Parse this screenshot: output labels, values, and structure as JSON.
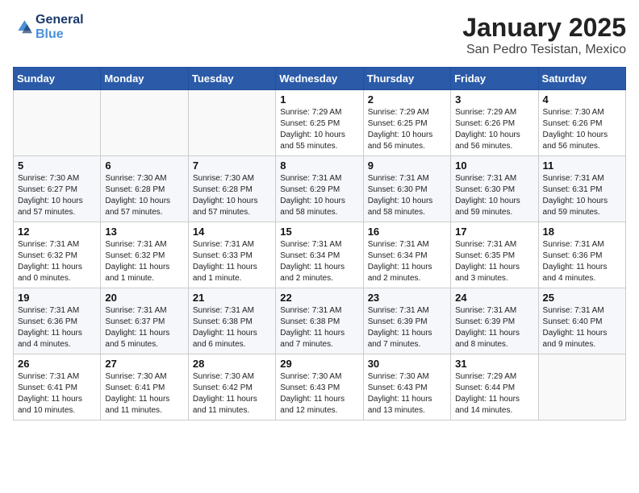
{
  "header": {
    "logo_line1": "General",
    "logo_line2": "Blue",
    "month": "January 2025",
    "location": "San Pedro Tesistan, Mexico"
  },
  "weekdays": [
    "Sunday",
    "Monday",
    "Tuesday",
    "Wednesday",
    "Thursday",
    "Friday",
    "Saturday"
  ],
  "weeks": [
    [
      {
        "day": "",
        "sunrise": "",
        "sunset": "",
        "daylight": ""
      },
      {
        "day": "",
        "sunrise": "",
        "sunset": "",
        "daylight": ""
      },
      {
        "day": "",
        "sunrise": "",
        "sunset": "",
        "daylight": ""
      },
      {
        "day": "1",
        "sunrise": "Sunrise: 7:29 AM",
        "sunset": "Sunset: 6:25 PM",
        "daylight": "Daylight: 10 hours and 55 minutes."
      },
      {
        "day": "2",
        "sunrise": "Sunrise: 7:29 AM",
        "sunset": "Sunset: 6:25 PM",
        "daylight": "Daylight: 10 hours and 56 minutes."
      },
      {
        "day": "3",
        "sunrise": "Sunrise: 7:29 AM",
        "sunset": "Sunset: 6:26 PM",
        "daylight": "Daylight: 10 hours and 56 minutes."
      },
      {
        "day": "4",
        "sunrise": "Sunrise: 7:30 AM",
        "sunset": "Sunset: 6:26 PM",
        "daylight": "Daylight: 10 hours and 56 minutes."
      }
    ],
    [
      {
        "day": "5",
        "sunrise": "Sunrise: 7:30 AM",
        "sunset": "Sunset: 6:27 PM",
        "daylight": "Daylight: 10 hours and 57 minutes."
      },
      {
        "day": "6",
        "sunrise": "Sunrise: 7:30 AM",
        "sunset": "Sunset: 6:28 PM",
        "daylight": "Daylight: 10 hours and 57 minutes."
      },
      {
        "day": "7",
        "sunrise": "Sunrise: 7:30 AM",
        "sunset": "Sunset: 6:28 PM",
        "daylight": "Daylight: 10 hours and 57 minutes."
      },
      {
        "day": "8",
        "sunrise": "Sunrise: 7:31 AM",
        "sunset": "Sunset: 6:29 PM",
        "daylight": "Daylight: 10 hours and 58 minutes."
      },
      {
        "day": "9",
        "sunrise": "Sunrise: 7:31 AM",
        "sunset": "Sunset: 6:30 PM",
        "daylight": "Daylight: 10 hours and 58 minutes."
      },
      {
        "day": "10",
        "sunrise": "Sunrise: 7:31 AM",
        "sunset": "Sunset: 6:30 PM",
        "daylight": "Daylight: 10 hours and 59 minutes."
      },
      {
        "day": "11",
        "sunrise": "Sunrise: 7:31 AM",
        "sunset": "Sunset: 6:31 PM",
        "daylight": "Daylight: 10 hours and 59 minutes."
      }
    ],
    [
      {
        "day": "12",
        "sunrise": "Sunrise: 7:31 AM",
        "sunset": "Sunset: 6:32 PM",
        "daylight": "Daylight: 11 hours and 0 minutes."
      },
      {
        "day": "13",
        "sunrise": "Sunrise: 7:31 AM",
        "sunset": "Sunset: 6:32 PM",
        "daylight": "Daylight: 11 hours and 1 minute."
      },
      {
        "day": "14",
        "sunrise": "Sunrise: 7:31 AM",
        "sunset": "Sunset: 6:33 PM",
        "daylight": "Daylight: 11 hours and 1 minute."
      },
      {
        "day": "15",
        "sunrise": "Sunrise: 7:31 AM",
        "sunset": "Sunset: 6:34 PM",
        "daylight": "Daylight: 11 hours and 2 minutes."
      },
      {
        "day": "16",
        "sunrise": "Sunrise: 7:31 AM",
        "sunset": "Sunset: 6:34 PM",
        "daylight": "Daylight: 11 hours and 2 minutes."
      },
      {
        "day": "17",
        "sunrise": "Sunrise: 7:31 AM",
        "sunset": "Sunset: 6:35 PM",
        "daylight": "Daylight: 11 hours and 3 minutes."
      },
      {
        "day": "18",
        "sunrise": "Sunrise: 7:31 AM",
        "sunset": "Sunset: 6:36 PM",
        "daylight": "Daylight: 11 hours and 4 minutes."
      }
    ],
    [
      {
        "day": "19",
        "sunrise": "Sunrise: 7:31 AM",
        "sunset": "Sunset: 6:36 PM",
        "daylight": "Daylight: 11 hours and 4 minutes."
      },
      {
        "day": "20",
        "sunrise": "Sunrise: 7:31 AM",
        "sunset": "Sunset: 6:37 PM",
        "daylight": "Daylight: 11 hours and 5 minutes."
      },
      {
        "day": "21",
        "sunrise": "Sunrise: 7:31 AM",
        "sunset": "Sunset: 6:38 PM",
        "daylight": "Daylight: 11 hours and 6 minutes."
      },
      {
        "day": "22",
        "sunrise": "Sunrise: 7:31 AM",
        "sunset": "Sunset: 6:38 PM",
        "daylight": "Daylight: 11 hours and 7 minutes."
      },
      {
        "day": "23",
        "sunrise": "Sunrise: 7:31 AM",
        "sunset": "Sunset: 6:39 PM",
        "daylight": "Daylight: 11 hours and 7 minutes."
      },
      {
        "day": "24",
        "sunrise": "Sunrise: 7:31 AM",
        "sunset": "Sunset: 6:39 PM",
        "daylight": "Daylight: 11 hours and 8 minutes."
      },
      {
        "day": "25",
        "sunrise": "Sunrise: 7:31 AM",
        "sunset": "Sunset: 6:40 PM",
        "daylight": "Daylight: 11 hours and 9 minutes."
      }
    ],
    [
      {
        "day": "26",
        "sunrise": "Sunrise: 7:31 AM",
        "sunset": "Sunset: 6:41 PM",
        "daylight": "Daylight: 11 hours and 10 minutes."
      },
      {
        "day": "27",
        "sunrise": "Sunrise: 7:30 AM",
        "sunset": "Sunset: 6:41 PM",
        "daylight": "Daylight: 11 hours and 11 minutes."
      },
      {
        "day": "28",
        "sunrise": "Sunrise: 7:30 AM",
        "sunset": "Sunset: 6:42 PM",
        "daylight": "Daylight: 11 hours and 11 minutes."
      },
      {
        "day": "29",
        "sunrise": "Sunrise: 7:30 AM",
        "sunset": "Sunset: 6:43 PM",
        "daylight": "Daylight: 11 hours and 12 minutes."
      },
      {
        "day": "30",
        "sunrise": "Sunrise: 7:30 AM",
        "sunset": "Sunset: 6:43 PM",
        "daylight": "Daylight: 11 hours and 13 minutes."
      },
      {
        "day": "31",
        "sunrise": "Sunrise: 7:29 AM",
        "sunset": "Sunset: 6:44 PM",
        "daylight": "Daylight: 11 hours and 14 minutes."
      },
      {
        "day": "",
        "sunrise": "",
        "sunset": "",
        "daylight": ""
      }
    ]
  ]
}
